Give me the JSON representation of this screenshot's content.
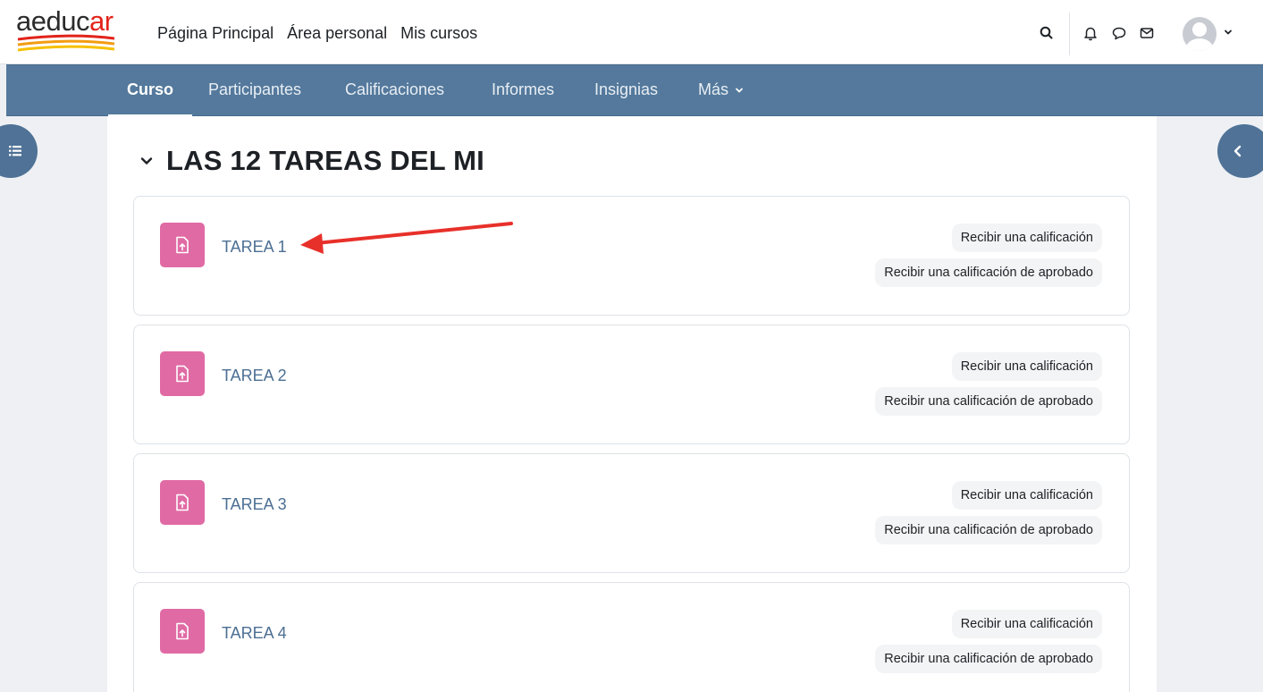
{
  "brand": {
    "logo_main": "aeduc",
    "logo_accent": "ar",
    "accent_color": "#e2231a"
  },
  "topnav": {
    "items": [
      "Página Principal",
      "Área personal",
      "Mis cursos"
    ]
  },
  "topbar_icons": [
    "search-icon",
    "bell-icon",
    "chat-icon",
    "mail-icon",
    "avatar",
    "chevron-down-icon"
  ],
  "secnav": {
    "items": [
      "Curso",
      "Participantes",
      "Calificaciones",
      "Informes",
      "Insignias",
      "Más"
    ],
    "active": "Curso",
    "bg_color": "#54799c"
  },
  "section": {
    "title": "LAS 12 TAREAS DEL MI"
  },
  "activities": [
    {
      "title": "TAREA 1",
      "badges": [
        "Recibir una calificación",
        "Recibir una calificación de aprobado"
      ]
    },
    {
      "title": "TAREA 2",
      "badges": [
        "Recibir una calificación",
        "Recibir una calificación de aprobado"
      ]
    },
    {
      "title": "TAREA 3",
      "badges": [
        "Recibir una calificación",
        "Recibir una calificación de aprobado"
      ]
    },
    {
      "title": "TAREA 4",
      "badges": [
        "Recibir una calificación",
        "Recibir una calificación de aprobado"
      ]
    }
  ],
  "activity_icon": {
    "name": "assignment-icon",
    "color": "#e06aa4"
  },
  "annotation": {
    "type": "red-arrow",
    "target": "TAREA 1",
    "color": "#e8302a"
  }
}
